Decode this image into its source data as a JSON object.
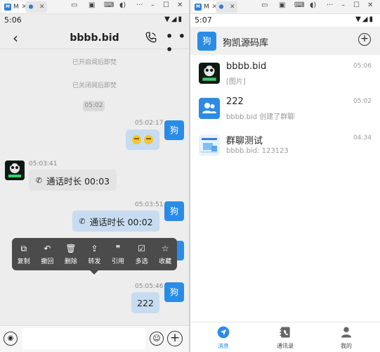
{
  "left": {
    "window": {
      "tabs": [
        {
          "label": "M"
        },
        {
          "label": ""
        }
      ],
      "logo": "M"
    },
    "status": {
      "time": "5:06"
    },
    "header": {
      "title": "bbbb.bid"
    },
    "system_notes": [
      "已开启阅后即焚",
      "已关闭阅后即焚"
    ],
    "time_pill": "05:02",
    "messages": [
      {
        "time": "05:02:17",
        "side": "right",
        "avatar": "狗"
      },
      {
        "time": "05:03:41",
        "side": "left",
        "text": "通话时长 00:03"
      },
      {
        "time": "05:03:51",
        "side": "right",
        "avatar": "狗",
        "text": "通话时长 00:02"
      },
      {
        "time": "05:05:46",
        "side": "right",
        "avatar": "狗",
        "text": "222"
      }
    ],
    "context_menu": [
      "复制",
      "撤回",
      "删除",
      "转发",
      "引用",
      "多选",
      "收藏"
    ]
  },
  "right": {
    "window": {
      "tabs": [
        {
          "label": "M"
        },
        {
          "label": ""
        }
      ],
      "logo": "M"
    },
    "status": {
      "time": "5:07"
    },
    "header": {
      "avatar": "狗",
      "title": "狗凯源码库"
    },
    "conversations": [
      {
        "name": "bbbb.bid",
        "preview": "[图片]",
        "time": "05:06"
      },
      {
        "name": "222",
        "preview": "bbbb.bid 创建了群聊",
        "time": "05:02"
      },
      {
        "name": "群聊测试",
        "preview": "bbbb.bid: 123123",
        "time": "04:34"
      }
    ],
    "nav": [
      "消息",
      "通讯录",
      "我的"
    ]
  },
  "colors": {
    "accent": "#2b8ce6",
    "bubble": "#c7dcf0",
    "menu": "#4b4b4b"
  }
}
